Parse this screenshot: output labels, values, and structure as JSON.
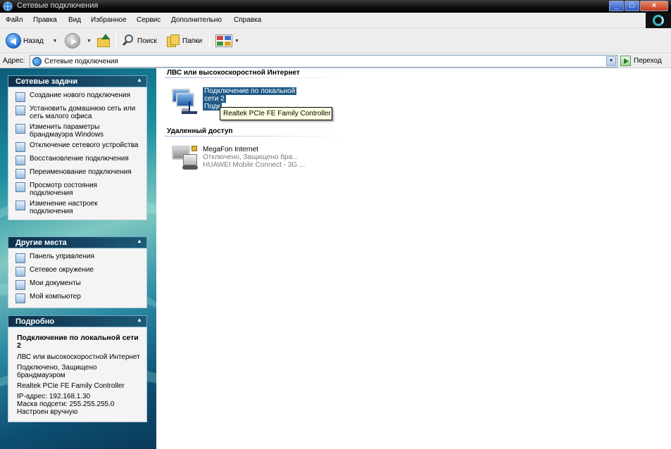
{
  "window": {
    "title": "Сетевые подключения",
    "buttons": {
      "minimize": "_",
      "maximize": "□",
      "close": "×"
    }
  },
  "menubar": [
    "Файл",
    "Правка",
    "Вид",
    "Избранное",
    "Сервис",
    "Дополнительно",
    "Справка"
  ],
  "toolbar": {
    "back_label": "Назад",
    "search_label": "Поиск",
    "folders_label": "Папки"
  },
  "address": {
    "label": "Адрес:",
    "value": "Сетевые подключения",
    "go_label": "Переход"
  },
  "left": {
    "tasks": {
      "title": "Сетевые задачи",
      "items": [
        {
          "label": "Создание нового подключения",
          "icon": "new-connection-icon"
        },
        {
          "label": "Установить домашнюю сеть или сеть малого офиса",
          "icon": "home-network-icon"
        },
        {
          "label": "Изменить параметры брандмауэра Windows",
          "icon": "firewall-icon"
        },
        {
          "label": "Отключение сетевого устройства",
          "icon": "disconnect-icon"
        },
        {
          "label": "Восстановление подключения",
          "icon": "repair-icon"
        },
        {
          "label": "Переименование подключения",
          "icon": "rename-icon"
        },
        {
          "label": "Просмотр состояния подключения",
          "icon": "status-icon"
        },
        {
          "label": "Изменение настроек подключения",
          "icon": "settings-icon"
        }
      ]
    },
    "places": {
      "title": "Другие места",
      "items": [
        {
          "label": "Панель управления",
          "icon": "control-panel-icon"
        },
        {
          "label": "Сетевое окружение",
          "icon": "network-places-icon"
        },
        {
          "label": "Мои документы",
          "icon": "my-documents-icon"
        },
        {
          "label": "Мой компьютер",
          "icon": "my-computer-icon"
        }
      ]
    },
    "details": {
      "title": "Подробно",
      "name": "Подключение по локальной сети 2",
      "type": "ЛВС или высокоскоростной Интернет",
      "status": "Подключено, Защищено брандмауэром",
      "device": "Realtek PCIe FE Family Controller",
      "ip": "IP-адрес: 192.168.1.30",
      "mask": "Маска подсети: 255.255.255.0",
      "config": "Настроен вручную"
    }
  },
  "content": {
    "lan_section": {
      "title": "ЛВС или высокоскоростной Интернет",
      "item": {
        "name_line1": "Подключение по локальной",
        "name_line2": "сети 2",
        "status_partial": "Подк"
      }
    },
    "remote_section": {
      "title": "Удаленный доступ",
      "item": {
        "name": "MegaFon Internet",
        "status": "Отключено, Защищено бра...",
        "device": "HUAWEI Mobile Connect - 3G ..."
      }
    },
    "tooltip": "Realtek PCIe FE Family Controller"
  },
  "colors": {
    "selection": "#1f5a86",
    "tooltip_bg": "#ffffe1",
    "panel_head": "#0e2f4a"
  }
}
